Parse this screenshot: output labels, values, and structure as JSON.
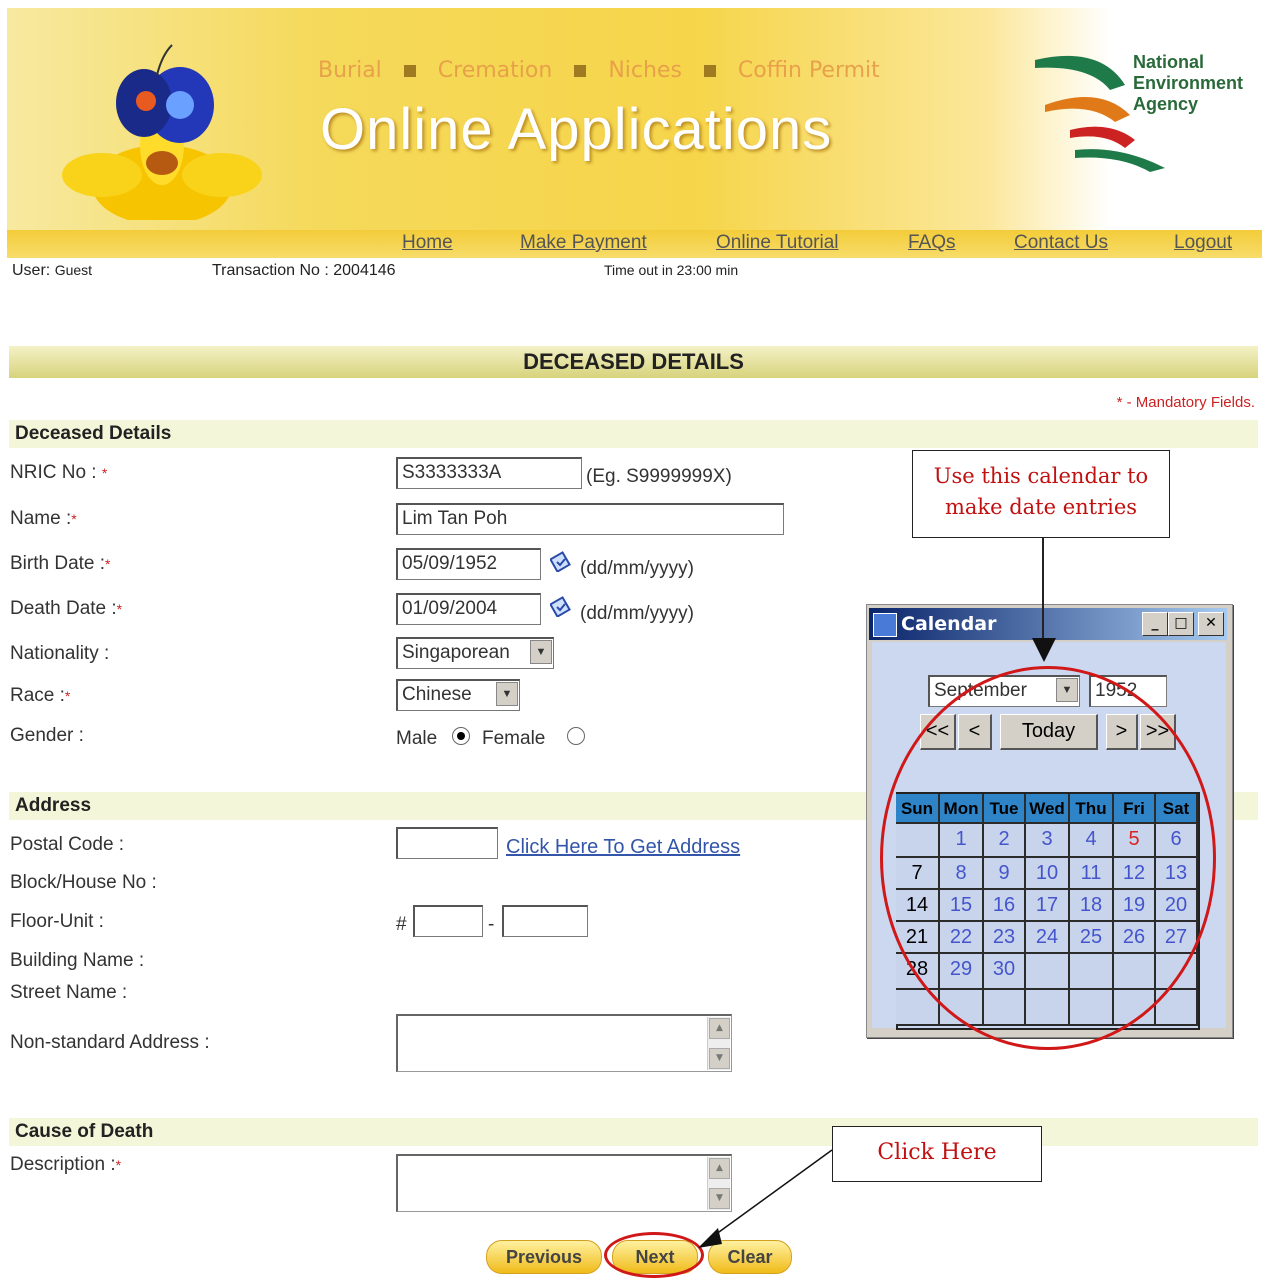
{
  "banner": {
    "links": [
      "Burial",
      "Cremation",
      "Niches",
      "Coffin Permit"
    ],
    "title": "Online Applications",
    "agency": [
      "National",
      "Environment",
      "Agency"
    ]
  },
  "nav": {
    "items": [
      "Home",
      "Make Payment",
      "Online Tutorial",
      "FAQs",
      "Contact Us",
      "Logout"
    ]
  },
  "session": {
    "user_label": "User:",
    "user": "Guest",
    "transaction_label": "Transaction No :",
    "transaction": "2004146",
    "timeout": "Time out in 23:00 min"
  },
  "page_title": "DECEASED DETAILS",
  "mandatory_note": "* - Mandatory Fields.",
  "deceased": {
    "section": "Deceased Details",
    "nric_label": "NRIC No :",
    "nric_value": "S3333333A",
    "nric_hint": "(Eg. S9999999X)",
    "name_label": "Name :",
    "name_value": "Lim Tan Poh",
    "birth_label": "Birth Date :",
    "birth_value": "05/09/1952",
    "date_hint": "(dd/mm/yyyy)",
    "death_label": "Death Date :",
    "death_value": "01/09/2004",
    "nationality_label": "Nationality :",
    "nationality_value": "Singaporean",
    "race_label": "Race :",
    "race_value": "Chinese",
    "gender_label": "Gender :",
    "gender_male": "Male",
    "gender_female": "Female"
  },
  "address": {
    "section": "Address",
    "postal_label": "Postal Code :",
    "get_address_link": "Click Here To Get Address",
    "block_label": "Block/House No :",
    "floor_label": "Floor-Unit :",
    "floor_hash": "#",
    "floor_dash": "-",
    "building_label": "Building Name :",
    "street_label": "Street Name :",
    "nonstandard_label": "Non-standard Address :"
  },
  "cause": {
    "section": "Cause of Death",
    "description_label": "Description :"
  },
  "buttons": {
    "previous": "Previous",
    "next": "Next",
    "clear": "Clear"
  },
  "calendar": {
    "title": "Calendar",
    "month": "September",
    "year": "1952",
    "prev_year": "<<",
    "prev_month": "<",
    "today": "Today",
    "next_month": ">",
    "next_year": ">>",
    "weekdays": [
      "Sun",
      "Mon",
      "Tue",
      "Wed",
      "Thu",
      "Fri",
      "Sat"
    ],
    "weeks": [
      [
        "",
        "1",
        "2",
        "3",
        "4",
        "5",
        "6"
      ],
      [
        "7",
        "8",
        "9",
        "10",
        "11",
        "12",
        "13"
      ],
      [
        "14",
        "15",
        "16",
        "17",
        "18",
        "19",
        "20"
      ],
      [
        "21",
        "22",
        "23",
        "24",
        "25",
        "26",
        "27"
      ],
      [
        "28",
        "29",
        "30",
        "",
        "",
        "",
        ""
      ],
      [
        "",
        "",
        "",
        "",
        "",
        "",
        ""
      ]
    ],
    "selected_day": "5"
  },
  "callouts": {
    "calendar_tip": "Use this calendar to make date entries",
    "click_here": "Click Here"
  },
  "colors": {
    "mandatory": "#cc2222",
    "link": "#3355aa",
    "callout_text": "#c01010",
    "button": "#f0bb1a",
    "calendar_header": "#2f84c8"
  }
}
